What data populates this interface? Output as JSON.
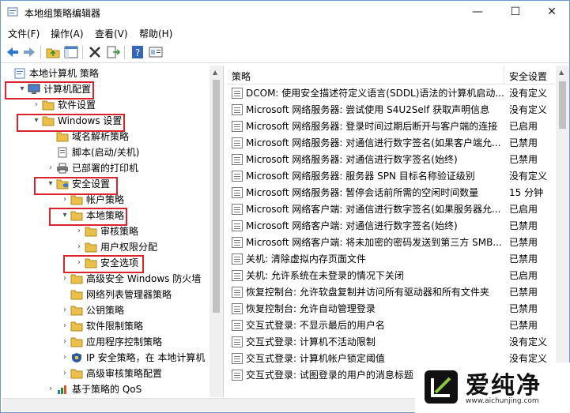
{
  "window": {
    "title": "本地组策略编辑器",
    "minimize": "—",
    "maximize": "☐",
    "close": "✕"
  },
  "menu": [
    "文件(F)",
    "操作(A)",
    "查看(V)",
    "帮助(H)"
  ],
  "toolbar": {
    "back_icon": "back-arrow-icon",
    "forward_icon": "forward-arrow-icon",
    "up_icon": "folder-up-icon",
    "show_tree_icon": "show-tree-icon",
    "delete_icon": "delete-icon",
    "export_icon": "export-list-icon",
    "help_icon": "help-icon",
    "properties_icon": "properties-icon"
  },
  "tree": [
    {
      "label": "本地计算机 策略",
      "icon": "computer-policy-icon",
      "arrow": ""
    },
    {
      "label": "计算机配置",
      "icon": "computer-icon",
      "arrow": "▾"
    },
    {
      "label": "软件设置",
      "icon": "folder-icon",
      "arrow": "›"
    },
    {
      "label": "Windows 设置",
      "icon": "folder-icon",
      "arrow": "▾"
    },
    {
      "label": "域名解析策略",
      "icon": "folder-icon",
      "arrow": ""
    },
    {
      "label": "脚本(启动/关机)",
      "icon": "script-icon",
      "arrow": ""
    },
    {
      "label": "已部署的打印机",
      "icon": "printer-icon",
      "arrow": "›"
    },
    {
      "label": "安全设置",
      "icon": "security-folder-icon",
      "arrow": "▾"
    },
    {
      "label": "帐户策略",
      "icon": "folder-icon",
      "arrow": "›"
    },
    {
      "label": "本地策略",
      "icon": "folder-icon",
      "arrow": "▾"
    },
    {
      "label": "审核策略",
      "icon": "folder-icon",
      "arrow": "›"
    },
    {
      "label": "用户权限分配",
      "icon": "folder-icon",
      "arrow": "›"
    },
    {
      "label": "安全选项",
      "icon": "folder-icon",
      "arrow": "›"
    },
    {
      "label": "高级安全 Windows 防火墙",
      "icon": "folder-icon",
      "arrow": "›"
    },
    {
      "label": "网络列表管理器策略",
      "icon": "folder-icon",
      "arrow": ""
    },
    {
      "label": "公钥策略",
      "icon": "folder-icon",
      "arrow": "›"
    },
    {
      "label": "软件限制策略",
      "icon": "folder-icon",
      "arrow": "›"
    },
    {
      "label": "应用程序控制策略",
      "icon": "folder-icon",
      "arrow": "›"
    },
    {
      "label": "IP 安全策略，在 本地计算机",
      "icon": "ip-security-icon",
      "arrow": "›"
    },
    {
      "label": "高级审核策略配置",
      "icon": "folder-icon",
      "arrow": "›"
    },
    {
      "label": "基于策略的 QoS",
      "icon": "qos-chart-icon",
      "arrow": "›"
    }
  ],
  "list": {
    "col_policy": "策略",
    "col_setting": "安全设置",
    "rows": [
      {
        "name": "DCOM: 使用安全描述符定义语言(SDDL)语法的计算机启动...",
        "setting": "没有定义"
      },
      {
        "name": "Microsoft 网络服务器: 尝试使用 S4U2Self 获取声明信息",
        "setting": "没有定义"
      },
      {
        "name": "Microsoft 网络服务器: 登录时间过期后断开与客户端的连接",
        "setting": "已启用"
      },
      {
        "name": "Microsoft 网络服务器: 对通信进行数字签名(如果客户端允...",
        "setting": "已禁用"
      },
      {
        "name": "Microsoft 网络服务器: 对通信进行数字签名(始终)",
        "setting": "已禁用"
      },
      {
        "name": "Microsoft 网络服务器: 服务器 SPN 目标名称验证级别",
        "setting": "没有定义"
      },
      {
        "name": "Microsoft 网络服务器: 暂停会话前所需的空闲时间数量",
        "setting": "15 分钟"
      },
      {
        "name": "Microsoft 网络客户端: 对通信进行数字签名(如果服务器允...",
        "setting": "已启用"
      },
      {
        "name": "Microsoft 网络客户端: 对通信进行数字签名(始终)",
        "setting": "已禁用"
      },
      {
        "name": "Microsoft 网络客户端: 将未加密的密码发送到第三方 SMB...",
        "setting": "已禁用"
      },
      {
        "name": "关机: 清除虚拟内存页面文件",
        "setting": "已禁用"
      },
      {
        "name": "关机: 允许系统在未登录的情况下关闭",
        "setting": "已启用"
      },
      {
        "name": "恢复控制台: 允许软盘复制并访问所有驱动器和所有文件夹",
        "setting": "已禁用"
      },
      {
        "name": "恢复控制台: 允许自动管理登录",
        "setting": "已禁用"
      },
      {
        "name": "交互式登录: 不显示最后的用户名",
        "setting": "已禁用"
      },
      {
        "name": "交互式登录: 计算机不活动限制",
        "setting": "没有定义"
      },
      {
        "name": "交互式登录: 计算机帐户锁定阈值",
        "setting": "没有定义"
      },
      {
        "name": "交互式登录: 试图登录的用户的消息标题",
        "setting": ""
      }
    ]
  },
  "watermark": {
    "text": "爱纯净",
    "url": "www.aichunjing.com",
    "icon": "aichunjing-logo-icon"
  },
  "colors": {
    "highlight_border": "#d9232d",
    "folder": "#e8c04a",
    "accent": "#1f6fc5"
  }
}
